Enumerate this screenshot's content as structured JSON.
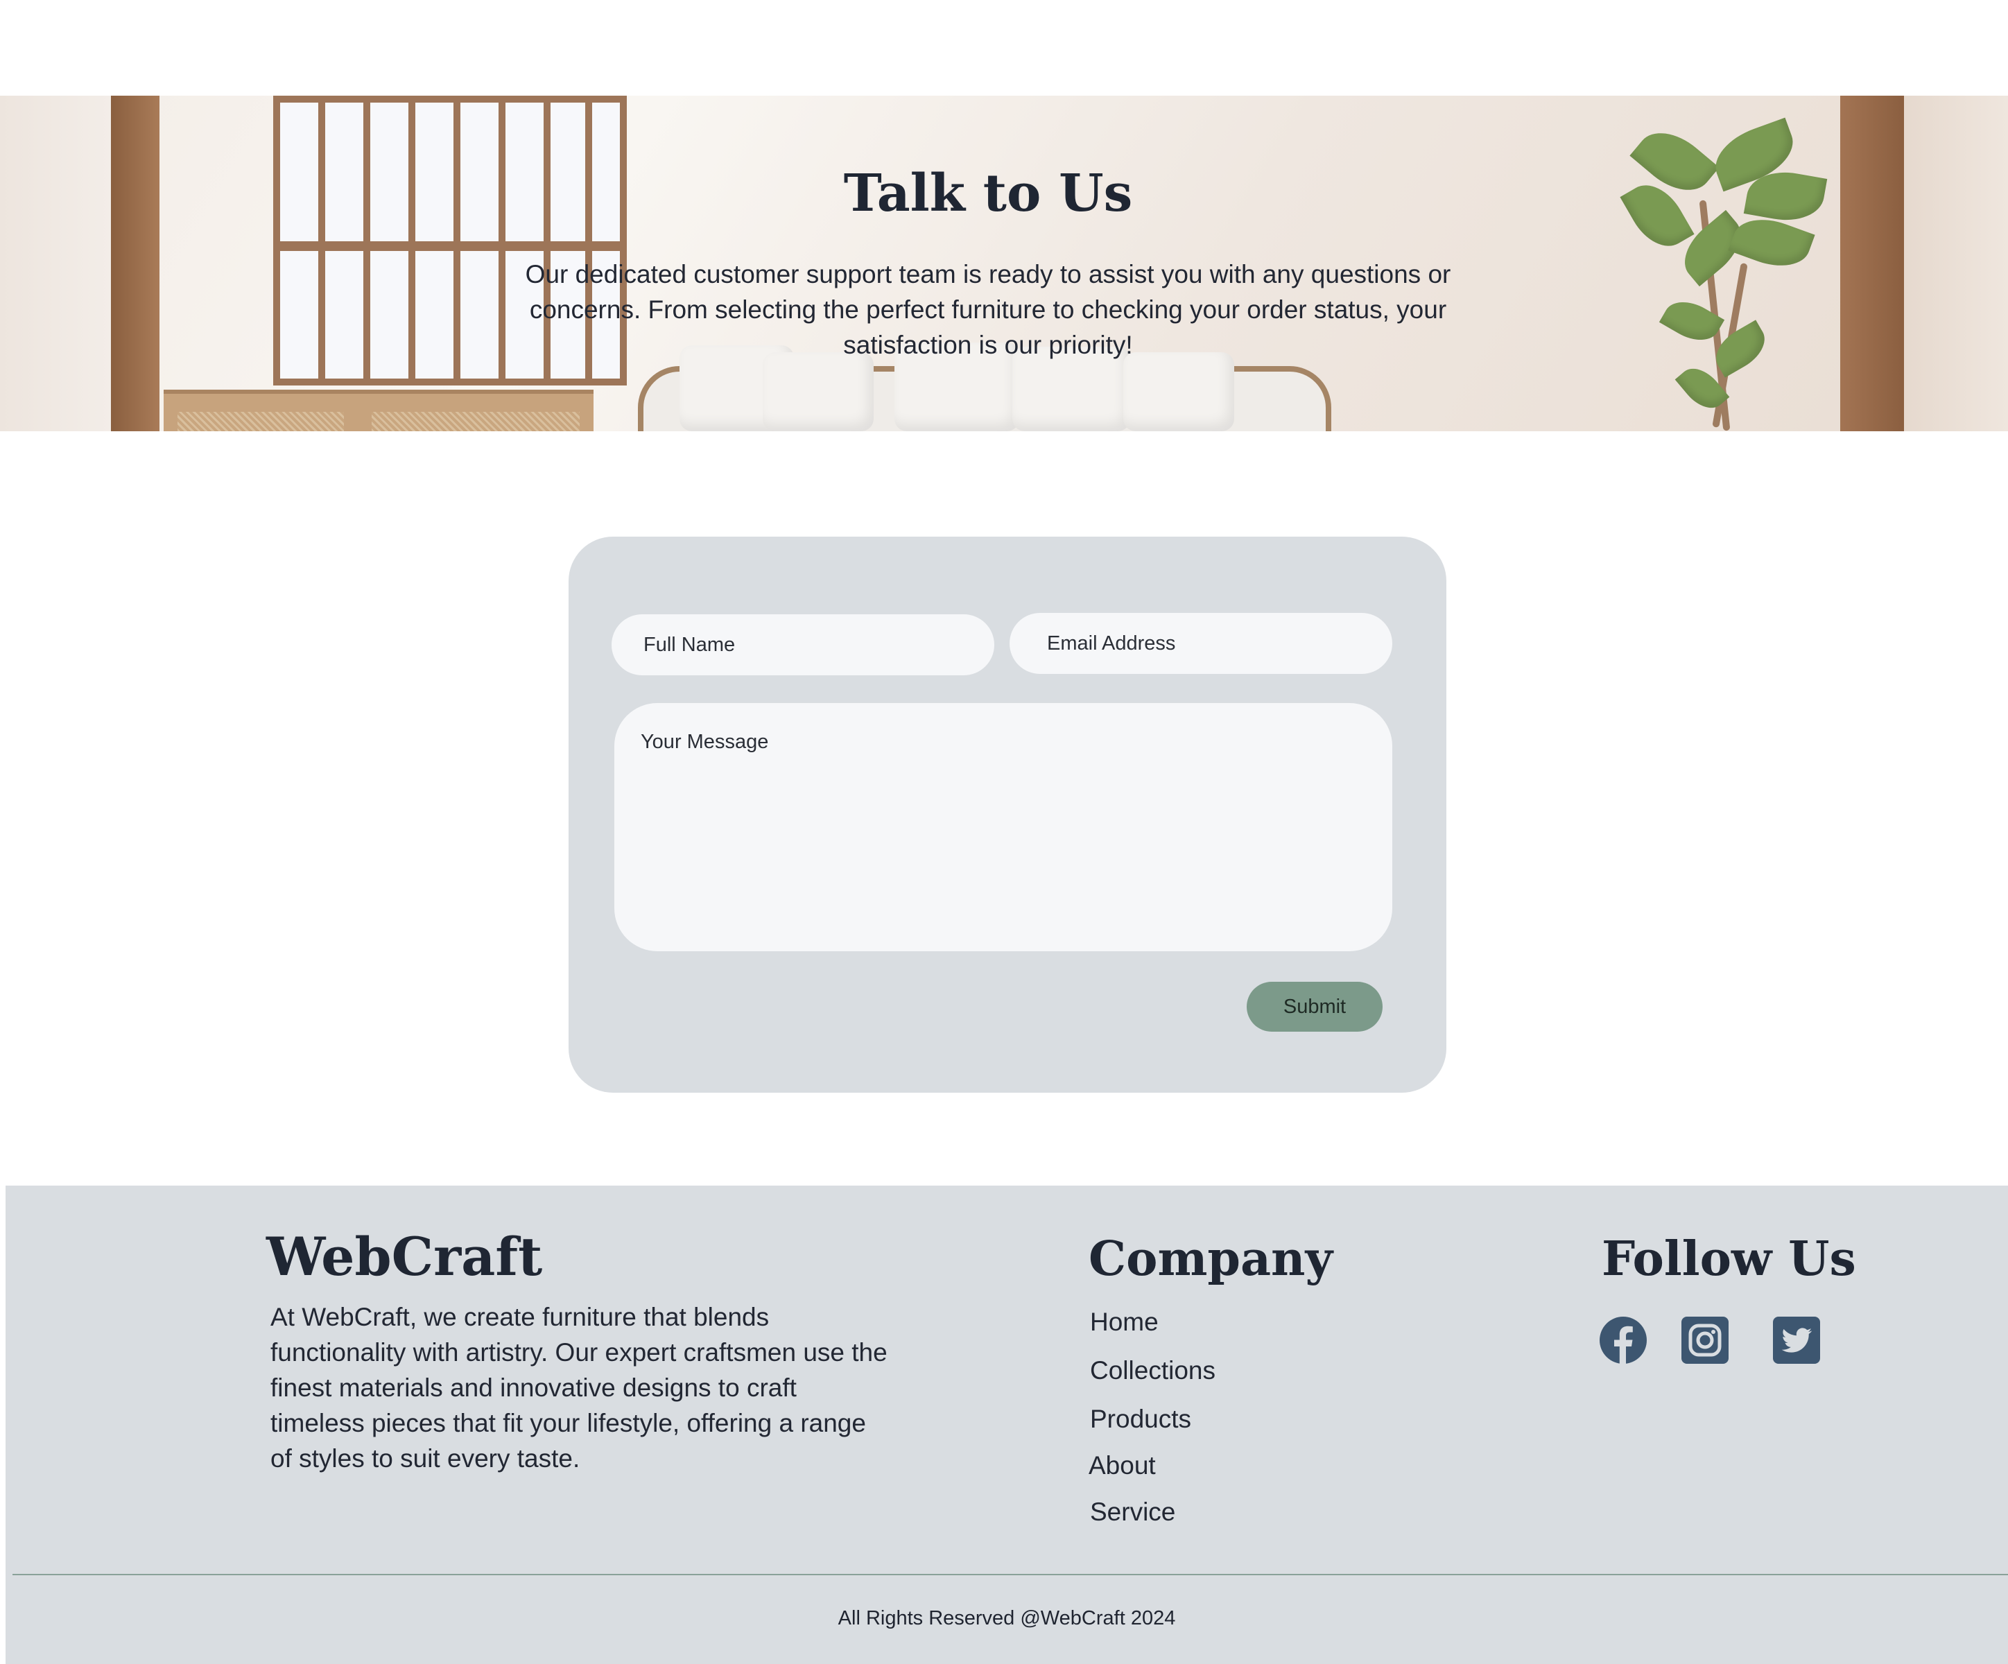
{
  "hero": {
    "title": "Talk to Us",
    "description": "Our dedicated customer support team is ready to assist you with any questions or concerns. From selecting the perfect furniture to checking your order status, your satisfaction is our priority!"
  },
  "form": {
    "full_name_placeholder": "Full Name",
    "email_placeholder": "Email Address",
    "message_placeholder": "Your Message",
    "submit_label": "Submit"
  },
  "footer": {
    "brand": "WebCraft",
    "about": "At WebCraft, we create furniture that blends functionality with artistry. Our expert craftsmen use the finest materials and innovative designs to craft timeless pieces that fit your lifestyle, offering a range of styles to suit every taste.",
    "company_title": "Company",
    "company_links": [
      "Home",
      "Collections",
      "Products",
      "About",
      "Service"
    ],
    "follow_title": "Follow Us",
    "social_icons": [
      "facebook-icon",
      "instagram-icon",
      "twitter-icon"
    ],
    "copyright": "All Rights Reserved @WebCraft 2024"
  },
  "colors": {
    "panel": "#d9dde1",
    "field": "#f6f7f9",
    "submit": "#7c9a8a",
    "icon": "#3d5670",
    "heading": "#1f2633"
  }
}
